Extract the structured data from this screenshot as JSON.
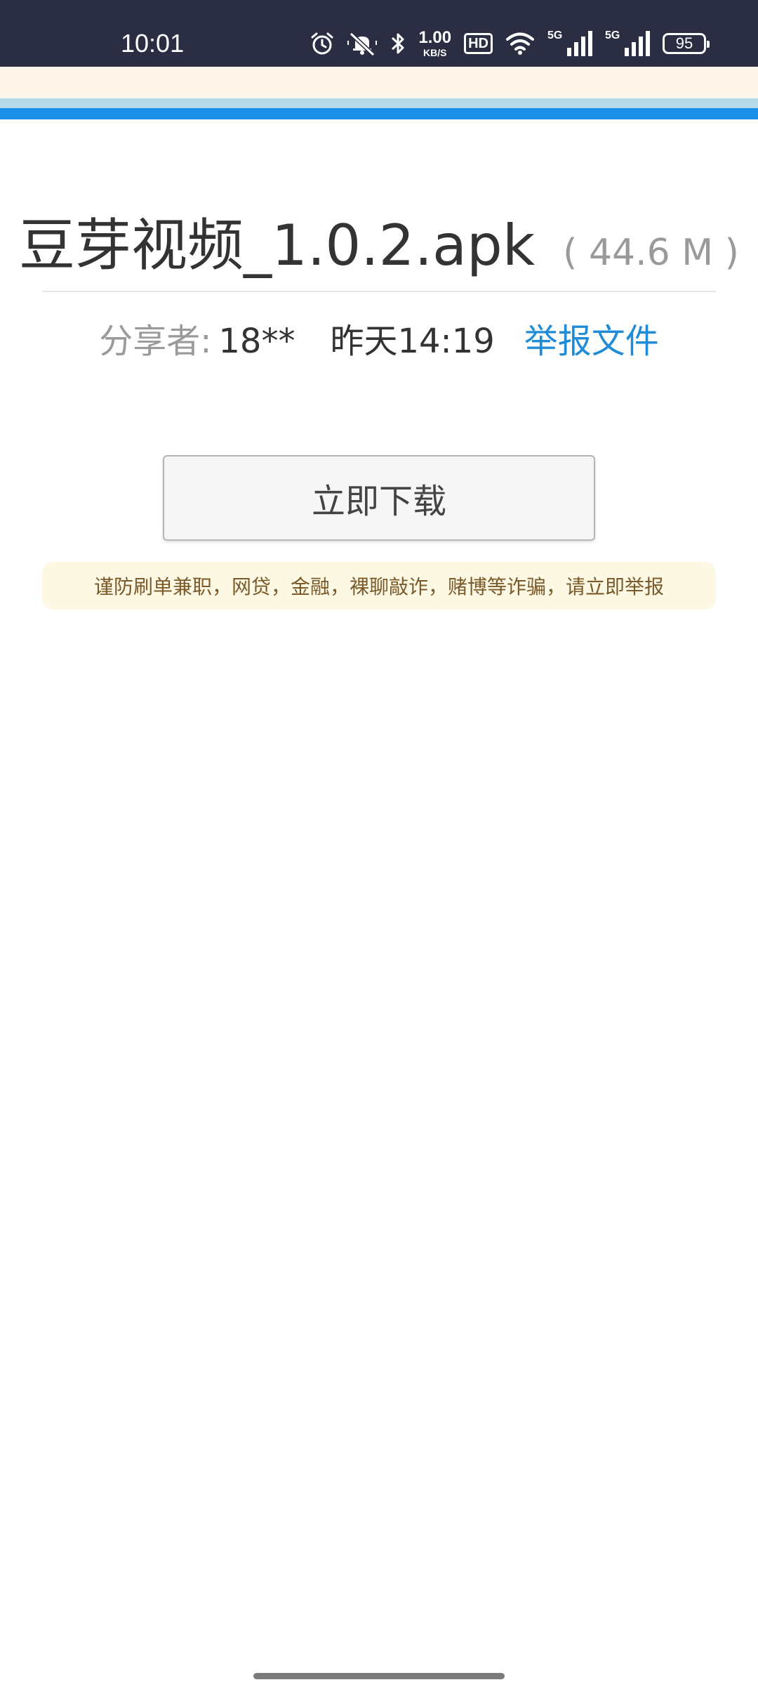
{
  "status_bar": {
    "time": "10:01",
    "net_speed_value": "1.00",
    "net_speed_unit": "KB/S",
    "hd_label": "HD",
    "signal1_label": "5G",
    "signal2_label": "5G",
    "battery_level": "95",
    "icons": [
      "alarm-icon",
      "mute-icon",
      "bluetooth-icon",
      "wifi-icon"
    ]
  },
  "file": {
    "name": "豆芽视频_1.0.2.apk",
    "size": "( 44.6 M )"
  },
  "meta": {
    "sharer_label": "分享者:",
    "sharer_value": "18**",
    "time": "昨天14:19",
    "report_label": "举报文件"
  },
  "download": {
    "label": "立即下载"
  },
  "warning": {
    "text": "谨防刷单兼职，网贷，金融，裸聊敲诈，赌博等诈骗，请立即举报"
  },
  "colors": {
    "status_bar_bg": "#2b2d42",
    "accent_blue": "#1b8fe8",
    "link_blue": "#1f8cd8",
    "warning_bg": "#fdf8e3",
    "warning_text": "#7a5a2a"
  }
}
